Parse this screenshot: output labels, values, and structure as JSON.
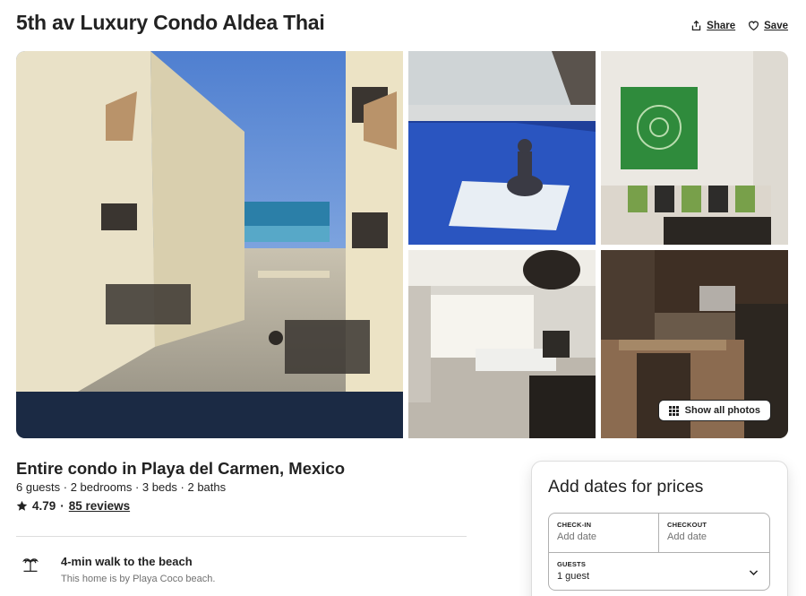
{
  "header": {
    "title": "5th av Luxury Condo Aldea Thai",
    "share_label": "Share",
    "save_label": "Save"
  },
  "gallery": {
    "show_all_label": "Show all photos",
    "photos": [
      "main-courtyard-photo",
      "pool-buddha-photo",
      "sofa-artwork-photo",
      "living-room-photo",
      "kitchen-photo"
    ]
  },
  "listing": {
    "title": "Entire condo in Playa del Carmen, Mexico",
    "summary": "6 guests · 2 bedrooms · 3 beds · 2 baths",
    "rating": "4.79",
    "separator": "·",
    "reviews_label": "85 reviews"
  },
  "highlights": [
    {
      "icon": "palm-tree-icon",
      "title": "4-min walk to the beach",
      "description": "This home is by Playa Coco beach."
    }
  ],
  "booking": {
    "title": "Add dates for prices",
    "checkin_label": "CHECK-IN",
    "checkin_value": "Add date",
    "checkout_label": "CHECKOUT",
    "checkout_value": "Add date",
    "guests_label": "GUESTS",
    "guests_value": "1 guest"
  },
  "colors": {
    "text": "#222222",
    "muted": "#717171",
    "border": "#dddddd"
  }
}
